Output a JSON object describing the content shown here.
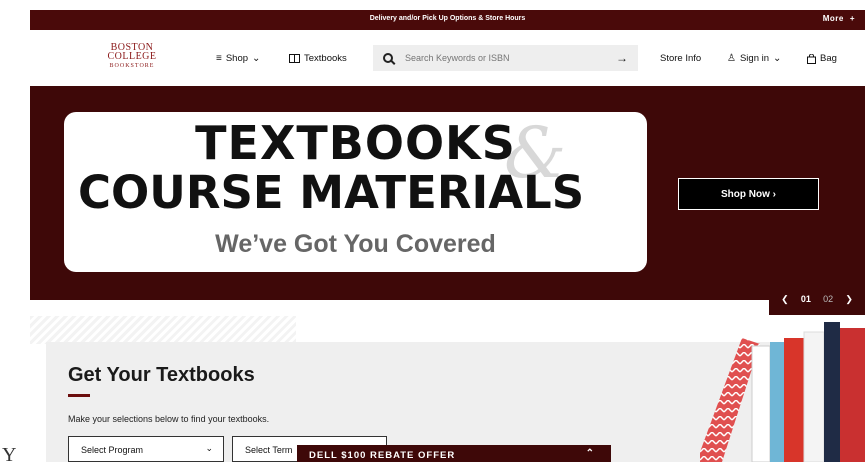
{
  "topbar": {
    "promo": "Delivery and/or Pick Up Options & Store Hours",
    "more_label": "More",
    "more_icon": "+"
  },
  "logo": {
    "line1": "BOSTON",
    "line2": "COLLEGE",
    "line3": "BOOKSTORE"
  },
  "nav": {
    "shop": "Shop",
    "textbooks": "Textbooks",
    "store_info": "Store Info",
    "sign_in": "Sign in",
    "bag": "Bag"
  },
  "search": {
    "placeholder": "Search Keywords or ISBN"
  },
  "hero": {
    "line1": "TEXTBOOKS",
    "ampersand": "&",
    "line2": "COURSE MATERIALS",
    "subtitle": "We’ve Got You Covered",
    "cta": "Shop Now",
    "cta_arrow": "›"
  },
  "pager": {
    "current": "01",
    "total": "02"
  },
  "textbooks_panel": {
    "title": "Get Your Textbooks",
    "description": "Make your selections below to find your textbooks.",
    "program_select": "Select Program",
    "term_select": "Select Term"
  },
  "rebate": {
    "label": "DELL $100 REBATE OFFER"
  },
  "ghost_char": "Y",
  "colors": {
    "brand": "#3e0808",
    "accent": "#6b0d0d",
    "logo": "#8b1a1a"
  }
}
